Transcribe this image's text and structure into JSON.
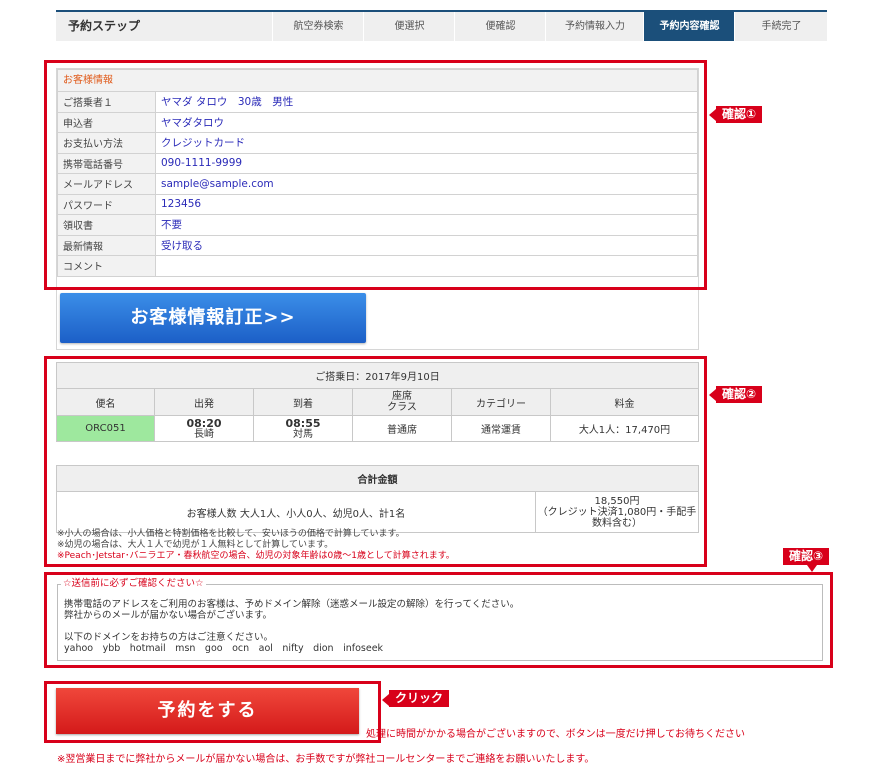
{
  "steps": {
    "title": "予約ステップ",
    "items": [
      {
        "label": "航空券検索"
      },
      {
        "label": "便選択"
      },
      {
        "label": "便確認"
      },
      {
        "label": "予約情報入力"
      },
      {
        "label": "予約内容確認",
        "active": true
      },
      {
        "label": "手続完了"
      }
    ]
  },
  "customer": {
    "section_title": "お客様情報",
    "rows": [
      {
        "label": "ご搭乗者１",
        "value": "ヤマダ タロウ　30歳　男性"
      },
      {
        "label": "申込者",
        "value": "ヤマダタロウ"
      },
      {
        "label": "お支払い方法",
        "value": "クレジットカード"
      },
      {
        "label": "携帯電話番号",
        "value": "090-1111-9999"
      },
      {
        "label": "メールアドレス",
        "value": "sample@sample.com"
      },
      {
        "label": "パスワード",
        "value": "123456"
      },
      {
        "label": "領収書",
        "value": "不要"
      },
      {
        "label": "最新情報",
        "value": "受け取る"
      },
      {
        "label": "コメント",
        "value": ""
      }
    ],
    "edit_button": "お客様情報訂正>>"
  },
  "flight": {
    "date_line": "ご搭乗日：2017年9月10日",
    "headers": [
      "便名",
      "出発",
      "到着",
      "座席\nクラス",
      "カテゴリー",
      "料金"
    ],
    "row": {
      "flight_no": "ORC051",
      "dep_time": "08:20",
      "dep_place": "長崎",
      "arr_time": "08:55",
      "arr_place": "対馬",
      "seat_class": "普通席",
      "category": "通常運賃",
      "fare": "大人1人：17,470円"
    },
    "total_title": "合計金額",
    "passengers": "お客様人数 大人1人、小人0人、幼児0人、計1名",
    "total_amount": "18,550円",
    "total_note": "（クレジット決済1,080円・手配手数料含む）",
    "notes": [
      "※小人の場合は、小人価格と特割価格を比較して、安いほうの価格で計算しています。",
      "※幼児の場合は、大人１人で幼児が１人無料として計算しています。"
    ],
    "note_red": "※Peach･Jetstar･バニラエア・春秋航空の場合、幼児の対象年齢は0歳〜1歳として計算されます。"
  },
  "confirm_box": {
    "legend": "☆送信前に必ずご確認ください☆",
    "lines": [
      "携帯電話のアドレスをご利用のお客様は、予めドメイン解除（迷惑メール設定の解除）を行ってください。",
      "弊社からのメールが届かない場合がございます。",
      "",
      "以下のドメインをお持ちの方はご注意ください。",
      "yahoo　ybb　hotmail　msn　goo　ocn　aol　nifty　dion　infoseek"
    ]
  },
  "tags": {
    "confirm1": "確認①",
    "confirm2": "確認②",
    "confirm3": "確認③",
    "click": "クリック"
  },
  "submit": {
    "button": "予約をする",
    "processing_note": "処理に時間がかかる場合がございますので、ボタンは一度だけ押してお待ちください",
    "footer_note": "※翌営業日までに弊社からメールが届かない場合は、お手数ですが弊社コールセンターまでご連絡をお願いいたします。"
  },
  "colors": {
    "accent_navy": "#1b4f7a",
    "frame_red": "#d8001a",
    "flight_green": "#9ee89e"
  }
}
